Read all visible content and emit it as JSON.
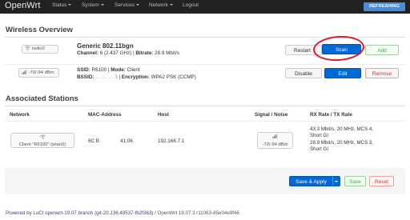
{
  "nav": {
    "brand": "OpenWrt",
    "menu": [
      {
        "label": "Status"
      },
      {
        "label": "System"
      },
      {
        "label": "Services"
      },
      {
        "label": "Network"
      }
    ],
    "logout": "Logout",
    "refresh_badge": "REFRESHING"
  },
  "wireless_overview": {
    "title": "Wireless Overview",
    "device": {
      "badge": "radio0",
      "name": "Generic 802.11bgn",
      "channel_label": "Channel:",
      "channel_value": "6 (2.437 GHz)",
      "bitrate_label": "Bitrate:",
      "bitrate_value": "28.9 Mbit/s",
      "restart_label": "Restart",
      "scan_label": "Scan",
      "add_label": "Add"
    },
    "network": {
      "signal_badge": "-70/-94 dBm",
      "ssid_label": "SSID:",
      "ssid_value": "R6100",
      "mode_label": "Mode:",
      "mode_value": "Client",
      "bssid_label": "BSSID:",
      "bssid_value": "… … … 3",
      "encryption_label": "Encryption:",
      "encryption_value": "WPA2 PSK (CCMP)",
      "disable_label": "Disable",
      "edit_label": "Edit",
      "remove_label": "Remove"
    }
  },
  "associated_stations": {
    "title": "Associated Stations",
    "columns": {
      "network": "Network",
      "mac": "MAC-Address",
      "host": "Host",
      "signal": "Signal / Noise",
      "rate": "RX Rate / TX Rate"
    },
    "row": {
      "network": "Client \"R6100\" (wlan0)",
      "mac_start": "6C B",
      "mac_end": "41:06",
      "host": "192.168.7.1",
      "signal": "-72/-94 dBm",
      "rx_rate_line1": "43.3 Mbit/s, 20 MHz, MCS 4,",
      "rx_rate_line2": "Short GI",
      "tx_rate_line1": "28.9 Mbit/s, 20 MHz, MCS 3,",
      "tx_rate_line2": "Short GI"
    }
  },
  "actions": {
    "save_apply_label": "Save & Apply",
    "save_label": "Save",
    "reset_label": "Reset"
  },
  "footer": {
    "link_text": "Powered by LuCI openwrt-19.07 branch (git-20.136.49537-fb2f363)",
    "version_text": " / OpenWrt 19.07.3 r11063-85e04e9f46"
  },
  "colors": {
    "navbar": "#222222",
    "primary": "#0069d6",
    "annotation": "#d81b2b"
  }
}
